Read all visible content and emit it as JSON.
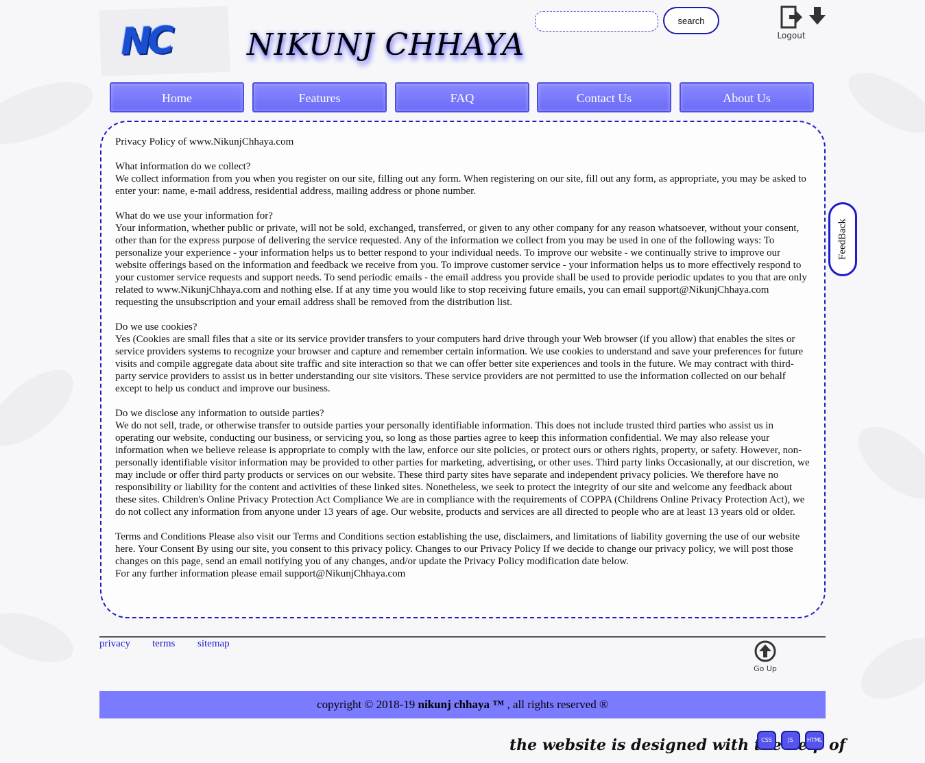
{
  "header": {
    "logo_text": "NC",
    "site_title": "NIKUNJ CHHAYA",
    "search": {
      "value": "",
      "placeholder": "",
      "button_label": "search"
    },
    "logout_label": "Logout"
  },
  "nav": {
    "items": [
      {
        "label": "Home"
      },
      {
        "label": "Features"
      },
      {
        "label": "FAQ"
      },
      {
        "label": "Contact Us"
      },
      {
        "label": "About Us"
      }
    ]
  },
  "content": {
    "title": "Privacy Policy of www.NikunjChhaya.com",
    "sections": [
      {
        "heading": "What information do we collect?",
        "body": "We collect information from you when you register on our site, filling out any form. When registering on our site, fill out any form, as appropriate, you may be asked to enter your: name, e-mail address, residential address, mailing address or phone number."
      },
      {
        "heading": "What do we use your information for?",
        "body": "Your information, whether public or private, will not be sold, exchanged, transferred, or given to any other company for any reason whatsoever, without your consent, other than for the express purpose of delivering the service requested. Any of the information we collect from you may be used in one of the following ways: To personalize your experience - your information helps us to better respond to your individual needs. To improve our website - we continually strive to improve our website offerings based on the information and feedback we receive from you. To improve customer service - your information helps us to more effectively respond to your customer service requests and support needs. To send periodic emails - the email address you provide shall be used to provide periodic updates to you that are only related to www.NikunjChhaya.com and nothing else. If at any time you would like to stop receiving future emails, you can email support@NikunjChhaya.com requesting the unsubscription and your email address shall be removed from the distribution list."
      },
      {
        "heading": "Do we use cookies?",
        "body": "Yes (Cookies are small files that a site or its service provider transfers to your computers hard drive through your Web browser (if you allow) that enables the sites or service providers systems to recognize your browser and capture and remember certain information. We use cookies to understand and save your preferences for future visits and compile aggregate data about site traffic and site interaction so that we can offer better site experiences and tools in the future. We may contract with third-party service providers to assist us in better understanding our site visitors. These service providers are not permitted to use the information collected on our behalf except to help us conduct and improve our business."
      },
      {
        "heading": "Do we disclose any information to outside parties?",
        "body": "We do not sell, trade, or otherwise transfer to outside parties your personally identifiable information. This does not include trusted third parties who assist us in operating our website, conducting our business, or servicing you, so long as those parties agree to keep this information confidential. We may also release your information when we believe release is appropriate to comply with the law, enforce our site policies, or protect ours or others rights, property, or safety. However, non-personally identifiable visitor information may be provided to other parties for marketing, advertising, or other uses. Third party links Occasionally, at our discretion, we may include or offer third party products or services on our website. These third party sites have separate and independent privacy policies. We therefore have no responsibility or liability for the content and activities of these linked sites. Nonetheless, we seek to protect the integrity of our site and welcome any feedback about these sites. Children's Online Privacy Protection Act Compliance We are in compliance with the requirements of COPPA (Childrens Online Privacy Protection Act), we do not collect any information from anyone under 13 years of age. Our website, products and services are all directed to people who are at least 13 years old or older."
      }
    ],
    "terms": "Terms and Conditions Please also visit our Terms and Conditions section establishing the use, disclaimers, and limitations of liability governing the use of our website here. Your Consent By using our site, you consent to this privacy policy. Changes to our Privacy Policy If we decide to change our privacy policy, we will post those changes on this page, send an email notifying you of any changes, and/or update the Privacy Policy modification date below.",
    "contact": "For any further information please email support@NikunjChhaya.com"
  },
  "feedback_label": "FeedBack",
  "footer": {
    "links": [
      {
        "label": "privacy"
      },
      {
        "label": "terms"
      },
      {
        "label": "sitemap"
      }
    ],
    "goup_label": "Go Up",
    "copyright_prefix": "copyright © 2018-19 ",
    "copyright_name": "nikunj chhaya ™",
    "copyright_suffix": " , all rights reserved ®",
    "credit": "the website is designed with the help of",
    "badges": [
      "CSS",
      "JS",
      "HTML"
    ]
  },
  "colors": {
    "accent": "#7b7bff",
    "border_blue": "#1c1cc8",
    "link": "#1a1acc"
  }
}
